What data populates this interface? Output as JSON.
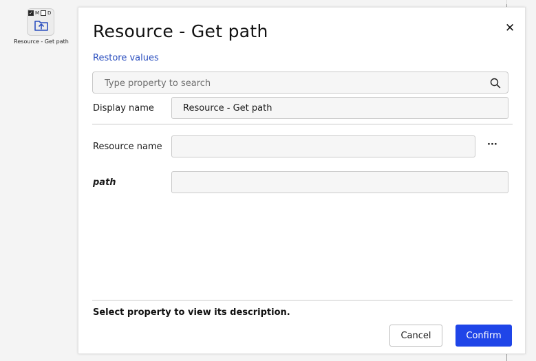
{
  "canvas": {
    "node": {
      "label": "Resource - Get path",
      "flags": [
        "M",
        "D"
      ],
      "icon": "folder-upload-icon"
    }
  },
  "dialog": {
    "title": "Resource - Get path",
    "close_icon": "close-icon",
    "restore_label": "Restore values",
    "search": {
      "placeholder": "Type property to search",
      "value": "",
      "icon": "search-icon"
    },
    "display_name": {
      "label": "Display name",
      "value": "Resource - Get path"
    },
    "properties": [
      {
        "label": "Resource name",
        "value": "",
        "more_label": "···"
      },
      {
        "label": "path",
        "value": ""
      }
    ],
    "description": "Select property to view its description.",
    "buttons": {
      "cancel": "Cancel",
      "confirm": "Confirm"
    },
    "colors": {
      "accent": "#1f45e8",
      "link": "#2b4fbf"
    }
  }
}
